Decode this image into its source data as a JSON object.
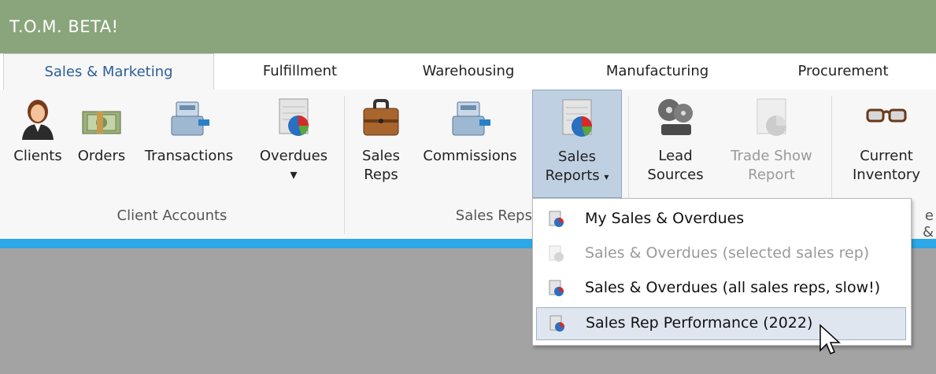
{
  "app": {
    "title": "T.O.M. BETA!"
  },
  "tabs": [
    {
      "label": "Sales & Marketing",
      "active": true
    },
    {
      "label": "Fulfillment"
    },
    {
      "label": "Warehousing"
    },
    {
      "label": "Manufacturing"
    },
    {
      "label": "Procurement"
    }
  ],
  "ribbon": {
    "clients": {
      "label": "Clients"
    },
    "orders": {
      "label": "Orders"
    },
    "transactions": {
      "label": "Transactions"
    },
    "overdues": {
      "label": "Overdues",
      "caret": "▾"
    },
    "sales_reps": {
      "label1": "Sales",
      "label2": "Reps"
    },
    "commissions": {
      "label": "Commissions"
    },
    "sales_reports": {
      "label1": "Sales",
      "label2": "Reports",
      "caret": "▾"
    },
    "lead_sources": {
      "label1": "Lead",
      "label2": "Sources"
    },
    "trade_show": {
      "label1": "Trade Show",
      "label2": "Report"
    },
    "current_inventory": {
      "label1": "Current",
      "label2": "Inventory"
    },
    "groups": {
      "client_accounts": "Client Accounts",
      "sales_reps": "Sales Reps",
      "partial": "e &"
    }
  },
  "menu": {
    "items": [
      {
        "label": "My Sales & Overdues",
        "enabled": true
      },
      {
        "label": "Sales & Overdues (selected sales rep)",
        "enabled": false
      },
      {
        "label": "Sales & Overdues (all sales reps, slow!)",
        "enabled": true
      },
      {
        "label": "Sales Rep Performance (2022)",
        "enabled": true,
        "highlighted": true
      }
    ]
  },
  "icons": {
    "clients": "person-icon",
    "orders": "money-icon",
    "transactions": "cash-register-icon",
    "overdues": "report-chart-icon",
    "sales_reps": "briefcase-icon",
    "commissions": "cash-register-icon",
    "sales_reports": "report-chart-icon",
    "lead_sources": "film-reel-icon",
    "trade_show": "report-chart-icon",
    "current_inventory": "glasses-icon"
  },
  "colors": {
    "titlebar": "#8aa57c",
    "accent_bar": "#2aa8e8",
    "active_tab_text": "#2a5f9a"
  }
}
